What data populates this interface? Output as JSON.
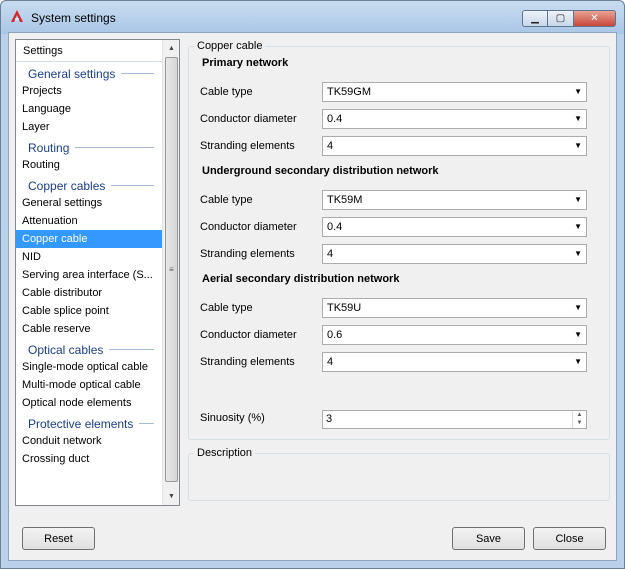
{
  "window": {
    "title": "System settings"
  },
  "sidebar": {
    "header": "Settings",
    "entries": [
      {
        "type": "group",
        "label": "General settings"
      },
      {
        "type": "item",
        "label": "Projects"
      },
      {
        "type": "item",
        "label": "Language"
      },
      {
        "type": "item",
        "label": "Layer"
      },
      {
        "type": "group",
        "label": "Routing"
      },
      {
        "type": "item",
        "label": "Routing"
      },
      {
        "type": "group",
        "label": "Copper cables"
      },
      {
        "type": "item",
        "label": "General settings"
      },
      {
        "type": "item",
        "label": "Attenuation"
      },
      {
        "type": "item",
        "label": "Copper cable",
        "selected": true
      },
      {
        "type": "item",
        "label": "NID"
      },
      {
        "type": "item",
        "label": "Serving area interface (S..."
      },
      {
        "type": "item",
        "label": "Cable distributor"
      },
      {
        "type": "item",
        "label": "Cable splice point"
      },
      {
        "type": "item",
        "label": "Cable reserve"
      },
      {
        "type": "group",
        "label": "Optical cables"
      },
      {
        "type": "item",
        "label": "Single-mode optical cable"
      },
      {
        "type": "item",
        "label": "Multi-mode optical cable"
      },
      {
        "type": "item",
        "label": "Optical node elements"
      },
      {
        "type": "group",
        "label": "Protective elements"
      },
      {
        "type": "item",
        "label": "Conduit network"
      },
      {
        "type": "item",
        "label": "Crossing duct"
      }
    ]
  },
  "panel": {
    "legend": "Copper cable",
    "sections": [
      {
        "title": "Primary network",
        "fields": [
          {
            "label": "Cable type",
            "value": "TK59GM"
          },
          {
            "label": "Conductor diameter",
            "value": "0.4"
          },
          {
            "label": "Stranding elements",
            "value": "4"
          }
        ]
      },
      {
        "title": "Underground secondary distribution network",
        "fields": [
          {
            "label": "Cable type",
            "value": "TK59M"
          },
          {
            "label": "Conductor diameter",
            "value": "0.4"
          },
          {
            "label": "Stranding elements",
            "value": "4"
          }
        ]
      },
      {
        "title": "Aerial secondary distribution network",
        "fields": [
          {
            "label": "Cable type",
            "value": "TK59U"
          },
          {
            "label": "Conductor diameter",
            "value": "0.6"
          },
          {
            "label": "Stranding elements",
            "value": "4"
          }
        ]
      }
    ],
    "sinuosity": {
      "label": "Sinuosity (%)",
      "value": "3"
    },
    "description_legend": "Description"
  },
  "buttons": {
    "reset": "Reset",
    "save": "Save",
    "close": "Close"
  },
  "colors": {
    "selection": "#3399ff",
    "group_heading": "#1a3e8c"
  }
}
